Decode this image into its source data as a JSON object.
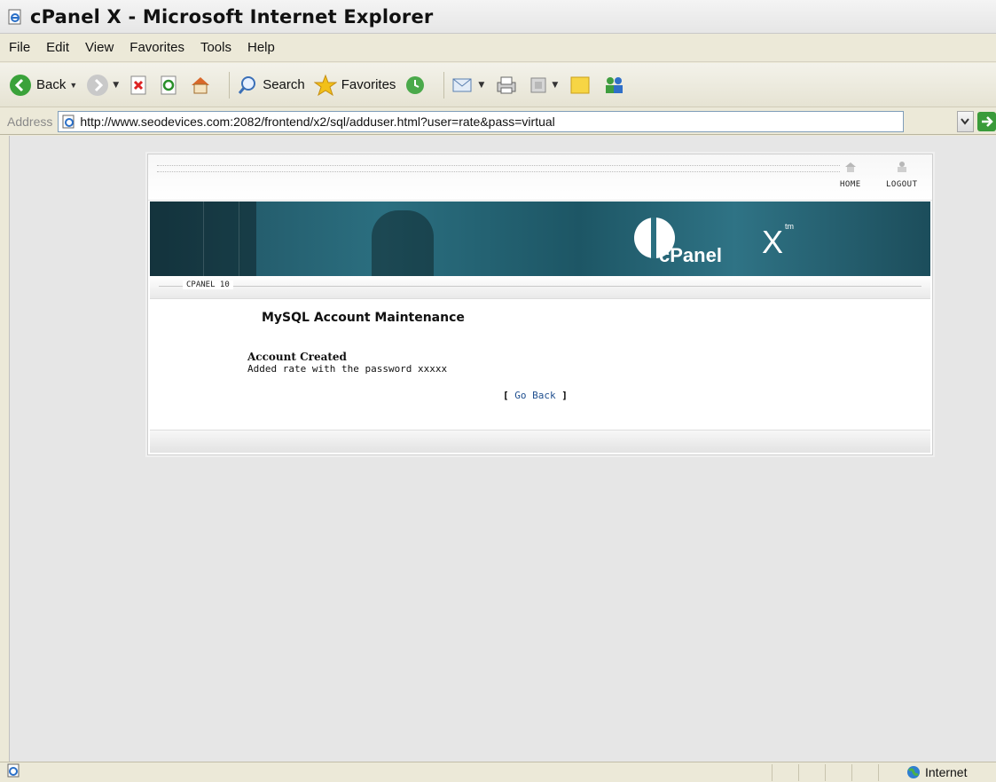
{
  "window": {
    "title": "cPanel X - Microsoft Internet Explorer"
  },
  "menu": {
    "items": [
      {
        "label": "File"
      },
      {
        "label": "Edit"
      },
      {
        "label": "View"
      },
      {
        "label": "Favorites"
      },
      {
        "label": "Tools"
      },
      {
        "label": "Help"
      }
    ]
  },
  "toolbar": {
    "back_label": "Back",
    "search_label": "Search",
    "favorites_label": "Favorites"
  },
  "address": {
    "label": "Address",
    "url": "http://www.seodevices.com:2082/frontend/x2/sql/adduser.html?user=rate&pass=virtual"
  },
  "page": {
    "top_links": {
      "home": "HOME",
      "logout": "LOGOUT"
    },
    "banner": {
      "logo_text": "cPanel",
      "logo_x": "X",
      "logo_tm": "tm"
    },
    "version_label": "CPANEL 10",
    "heading": "MySQL Account Maintenance",
    "message_title": "Account Created",
    "message_body": "Added rate with the password xxxxx",
    "go_back_label": "Go Back",
    "bracket_open": "[",
    "bracket_close": "]"
  },
  "status": {
    "zone": "Internet"
  },
  "colors": {
    "banner": "#2b6f80",
    "link": "#1f4f8f",
    "chrome": "#ece9d8"
  }
}
